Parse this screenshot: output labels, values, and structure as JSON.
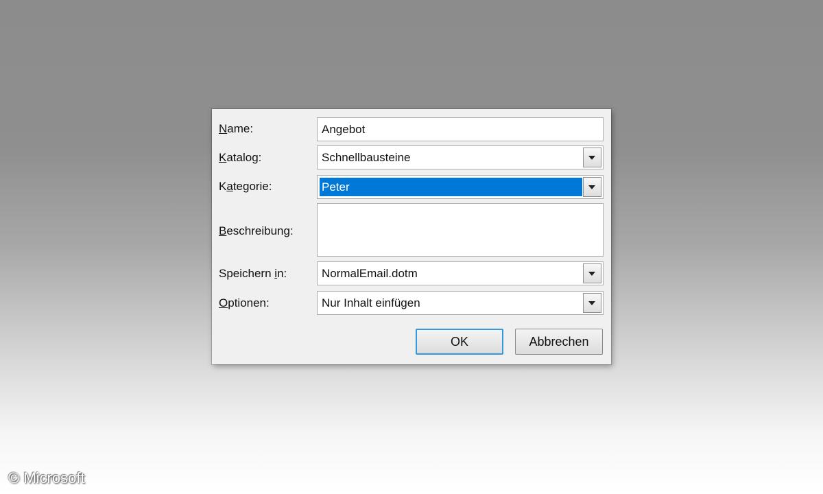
{
  "dialog": {
    "name": {
      "label_accel": "N",
      "label_rest": "ame:",
      "value": "Angebot"
    },
    "katalog": {
      "label_accel": "K",
      "label_rest": "atalog:",
      "value": "Schnellbausteine"
    },
    "kategorie": {
      "label_pre": "K",
      "label_accel": "a",
      "label_rest": "tegorie:",
      "value": "Peter"
    },
    "beschreibung": {
      "label_accel": "B",
      "label_rest": "eschreibung:",
      "value": ""
    },
    "speichern": {
      "label_pre": "Speichern ",
      "label_accel": "i",
      "label_rest": "n:",
      "value": "NormalEmail.dotm"
    },
    "optionen": {
      "label_accel": "O",
      "label_rest": "ptionen:",
      "value": "Nur Inhalt einfügen"
    },
    "buttons": {
      "ok": "OK",
      "cancel": "Abbrechen"
    }
  },
  "watermark": "© Microsoft",
  "colors": {
    "selection": "#0078d7",
    "focus_border": "#3399dd",
    "dialog_bg": "#f0f0f0"
  },
  "icons": {
    "dropdown": "chevron-down-icon"
  }
}
